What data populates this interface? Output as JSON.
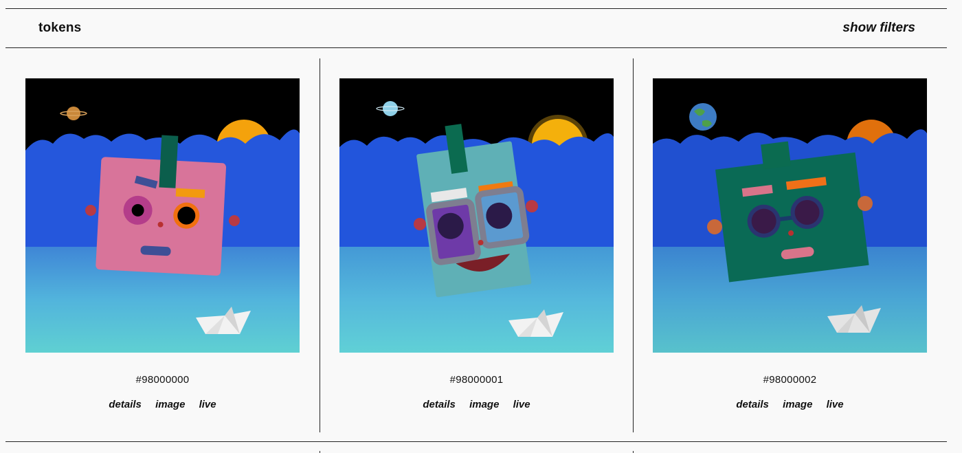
{
  "header": {
    "title": "tokens",
    "filters_label": "show filters"
  },
  "tokens": [
    {
      "id": "#98000000",
      "links": [
        "details",
        "image",
        "live"
      ]
    },
    {
      "id": "#98000001",
      "links": [
        "details",
        "image",
        "live"
      ]
    },
    {
      "id": "#98000002",
      "links": [
        "details",
        "image",
        "live"
      ]
    }
  ],
  "colors": {
    "sky": "#000000",
    "clouds": "#2a5be0",
    "sea_top": "#4aa6dc",
    "sea_bottom": "#5cc9d4",
    "face1": "#d8749a",
    "face2": "#5fb0b6",
    "face3": "#0a6a55"
  }
}
